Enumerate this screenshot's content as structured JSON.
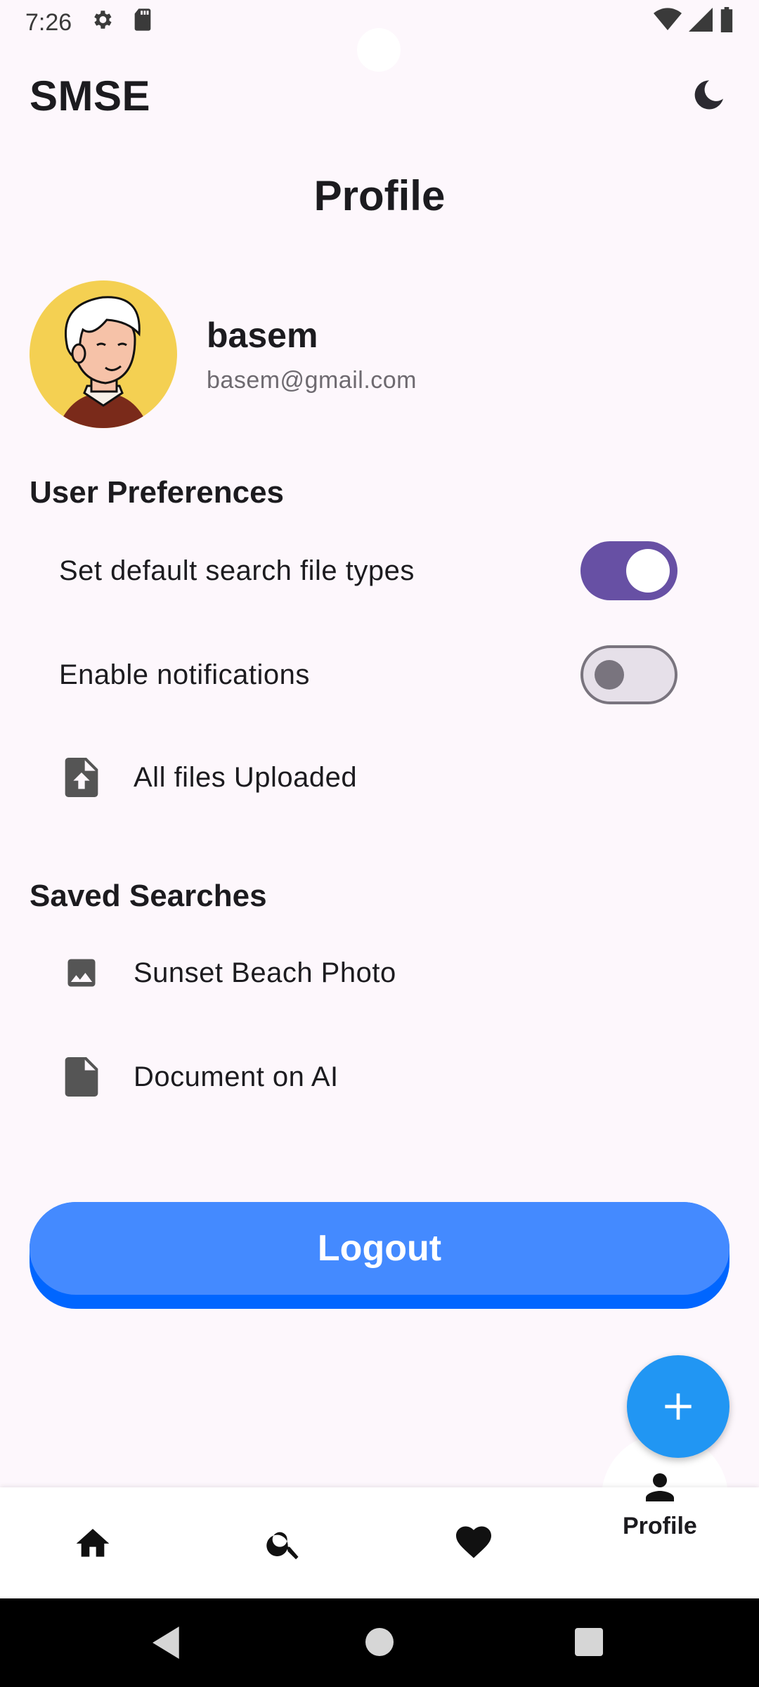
{
  "status_bar": {
    "time": "7:26"
  },
  "app_bar": {
    "title": "SMSE"
  },
  "page": {
    "title": "Profile"
  },
  "profile": {
    "name": "basem",
    "email": "basem@gmail.com"
  },
  "preferences": {
    "heading": "User Preferences",
    "items": [
      {
        "label": "Set default search file types",
        "toggle": true
      },
      {
        "label": "Enable notifications",
        "toggle": false
      }
    ],
    "uploads_label": "All files Uploaded"
  },
  "saved_searches": {
    "heading": "Saved Searches",
    "items": [
      {
        "label": "Sunset Beach Photo",
        "icon": "image-icon"
      },
      {
        "label": "Document on AI",
        "icon": "document-icon"
      }
    ]
  },
  "logout": {
    "label": "Logout"
  },
  "bottom_nav": {
    "items": [
      {
        "icon": "home-icon",
        "label": ""
      },
      {
        "icon": "search-icon",
        "label": ""
      },
      {
        "icon": "heart-icon",
        "label": ""
      },
      {
        "icon": "person-icon",
        "label": "Profile"
      }
    ],
    "active": "Profile"
  },
  "colors": {
    "background": "#fdf7fc",
    "switch_on": "#6750a4",
    "logout": "#448aff",
    "fab": "#2196f3"
  }
}
